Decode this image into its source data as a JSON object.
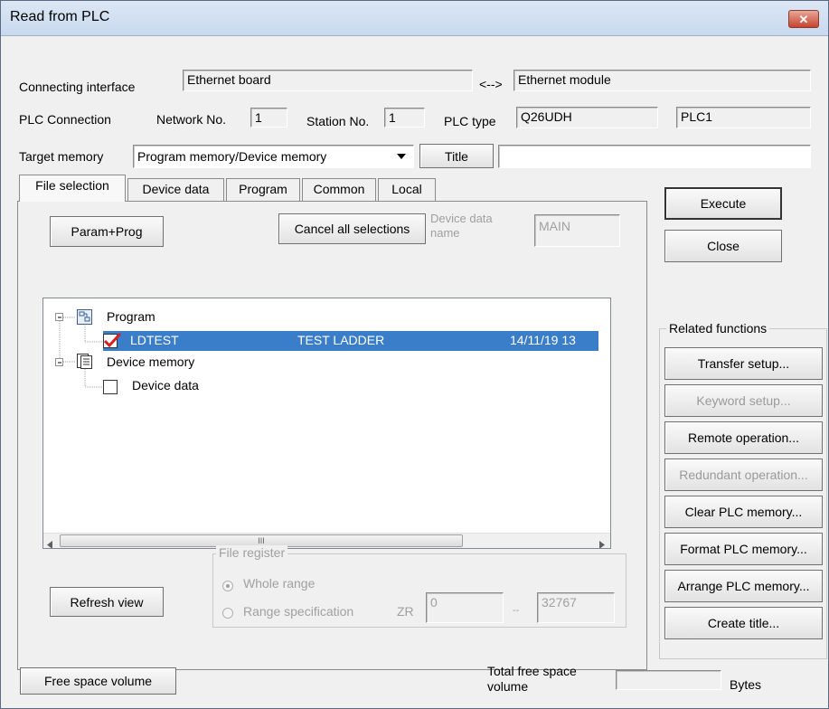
{
  "window": {
    "title": "Read from PLC",
    "close_glyph": "✕"
  },
  "connection": {
    "interface_label": "Connecting interface",
    "interface_value": "Ethernet board",
    "arrow": "<-->",
    "module_value": "Ethernet module",
    "plc_connection_label": "PLC Connection",
    "network_label": "Network No.",
    "network_value": "1",
    "station_label": "Station No.",
    "station_value": "1",
    "plc_type_label": "PLC type",
    "plc_type_value": "Q26UDH",
    "plc_name_value": "PLC1"
  },
  "target": {
    "label": "Target memory",
    "selected": "Program memory/Device memory",
    "title_button": "Title",
    "title_value": ""
  },
  "tabs": [
    {
      "label": "File selection",
      "active": true
    },
    {
      "label": "Device data"
    },
    {
      "label": "Program"
    },
    {
      "label": "Common"
    },
    {
      "label": "Local"
    }
  ],
  "file_selection": {
    "param_prog_button": "Param+Prog",
    "cancel_all_button": "Cancel all selections",
    "device_data_name_label_1": "Device data",
    "device_data_name_label_2": "name",
    "device_data_name_value": "MAIN",
    "tree": {
      "program_label": "Program",
      "row": {
        "name": "LDTEST",
        "title": "TEST LADDER",
        "date": "14/11/19 13"
      },
      "device_memory_label": "Device memory",
      "device_data_label": "Device data",
      "scroll_grip": "III"
    },
    "refresh_button": "Refresh view",
    "file_register": {
      "label": "File register",
      "whole_range": "Whole range",
      "range_spec": "Range specification",
      "zr_label": "ZR",
      "start_value": "0",
      "dash": "--",
      "end_value": "32767"
    }
  },
  "actions": {
    "execute": "Execute",
    "close": "Close"
  },
  "related": {
    "label": "Related functions",
    "buttons": [
      {
        "label": "Transfer setup...",
        "enabled": true
      },
      {
        "label": "Keyword setup...",
        "enabled": false
      },
      {
        "label": "Remote operation...",
        "enabled": true
      },
      {
        "label": "Redundant operation...",
        "enabled": false
      },
      {
        "label": "Clear PLC memory...",
        "enabled": true
      },
      {
        "label": "Format PLC memory...",
        "enabled": true
      },
      {
        "label": "Arrange PLC memory...",
        "enabled": true
      },
      {
        "label": "Create title...",
        "enabled": true
      }
    ]
  },
  "footer": {
    "free_space_button": "Free space volume",
    "total_free_label_1": "Total free space",
    "total_free_label_2": "volume",
    "total_free_value": "",
    "bytes_label": "Bytes"
  },
  "colors": {
    "selection": "#3a7ec9",
    "check_red": "#d42020"
  }
}
